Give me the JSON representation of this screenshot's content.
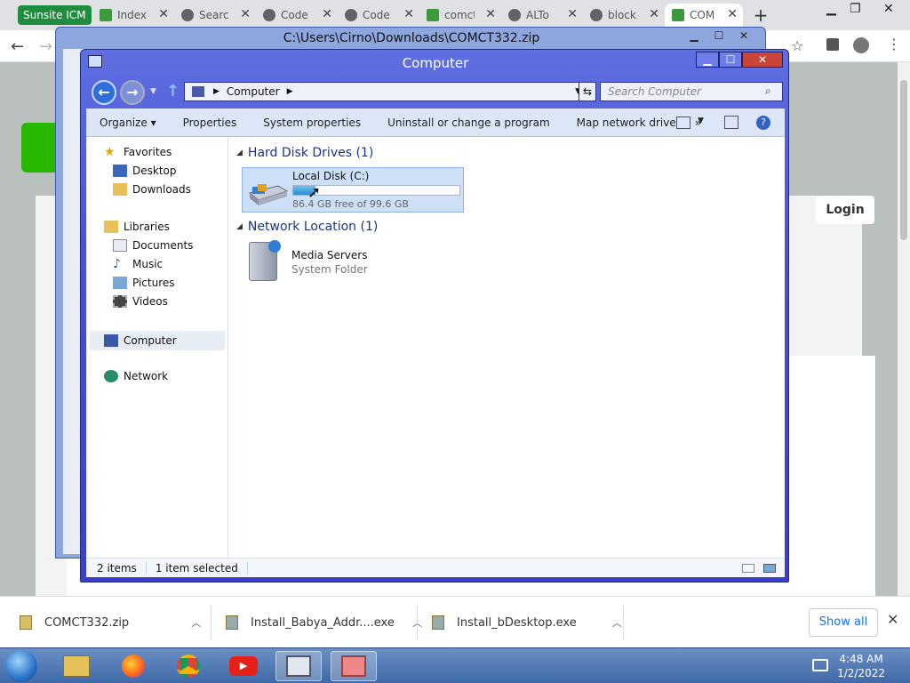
{
  "browser": {
    "group_label": "Sunsite ICM",
    "tabs": [
      {
        "label": "Index",
        "icon": "chart-icon"
      },
      {
        "label": "Searc",
        "icon": "globe-icon"
      },
      {
        "label": "Code",
        "icon": "globe-icon"
      },
      {
        "label": "Code",
        "icon": "globe-icon"
      },
      {
        "label": "comct",
        "icon": "ocx-icon"
      },
      {
        "label": "ALTo",
        "icon": "globe-icon"
      },
      {
        "label": "block",
        "icon": "globe-icon"
      },
      {
        "label": "COM",
        "icon": "ocx-icon"
      }
    ],
    "new_tab": "+"
  },
  "webpage": {
    "login_label": "Login"
  },
  "zip_window": {
    "title": "C:\\Users\\Cirno\\Downloads\\COMCT332.zip"
  },
  "explorer": {
    "title": "Computer",
    "address": "Computer",
    "search_placeholder": "Search Computer",
    "commands": [
      "Organize ▾",
      "Properties",
      "System properties",
      "Uninstall or change a program",
      "Map network drive",
      "»"
    ],
    "nav": {
      "favorites": "Favorites",
      "desktop": "Desktop",
      "downloads": "Downloads",
      "libraries": "Libraries",
      "documents": "Documents",
      "music": "Music",
      "pictures": "Pictures",
      "videos": "Videos",
      "computer": "Computer",
      "network": "Network"
    },
    "groups": {
      "hdd": "Hard Disk Drives (1)",
      "net": "Network Location (1)"
    },
    "disk": {
      "name": "Local Disk (C:)",
      "free_text": "86.4 GB free of 99.6 GB",
      "used_fraction": 0.133
    },
    "media": {
      "name": "Media Servers",
      "type": "System Folder"
    },
    "status": {
      "count": "2 items",
      "selected": "1 item selected"
    }
  },
  "downloads": {
    "items": [
      {
        "name": "COMCT332.zip"
      },
      {
        "name": "Install_Babya_Addr....exe"
      },
      {
        "name": "Install_bDesktop.exe"
      }
    ],
    "show_all": "Show all"
  },
  "taskbar": {
    "time": "4:48 AM",
    "date": "1/2/2022"
  },
  "colors": {
    "window_frame": "#4a4fd8",
    "selection": "#cde0f7",
    "group_header": "#1e3287"
  }
}
